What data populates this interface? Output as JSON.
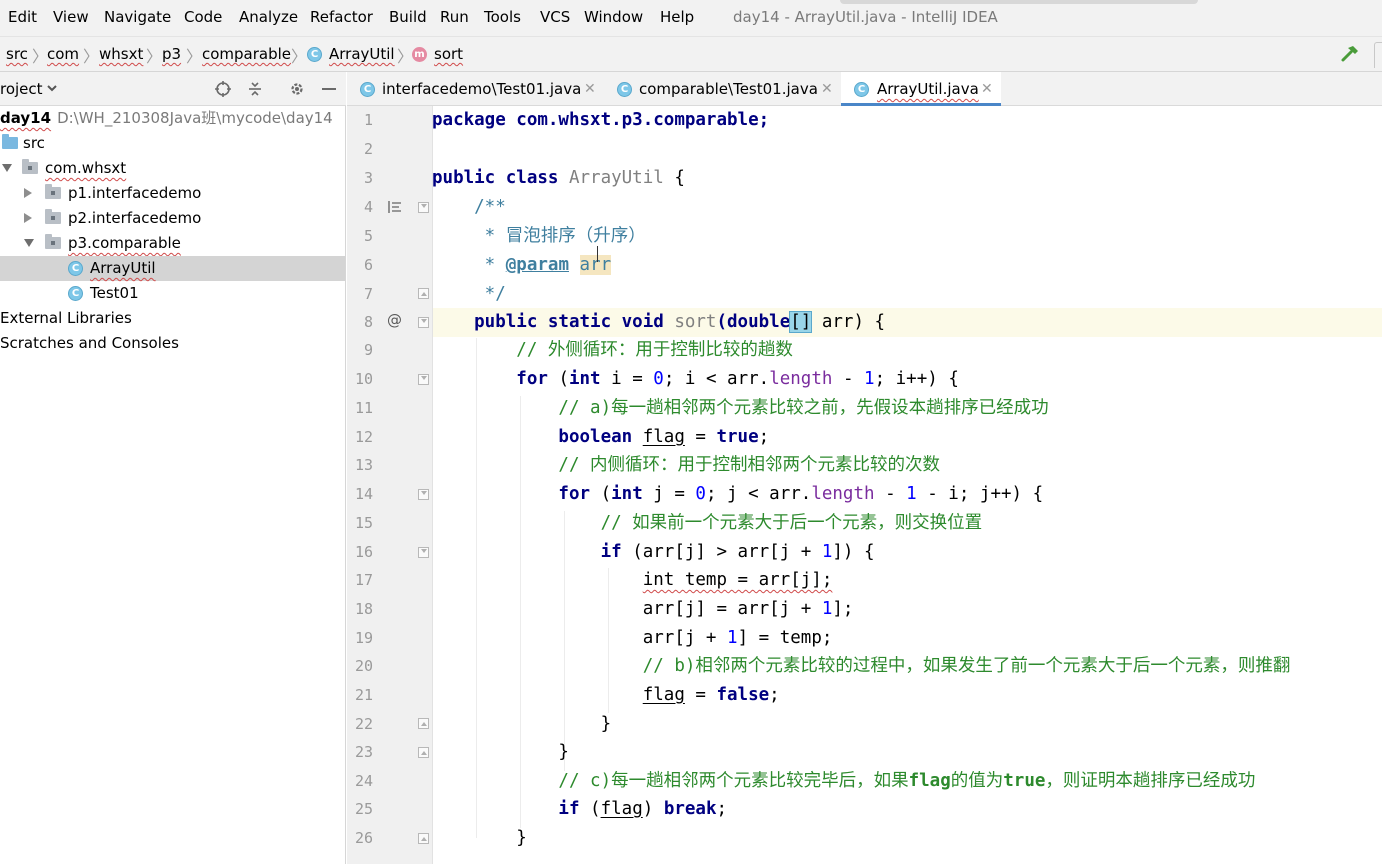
{
  "menu": {
    "items": [
      "Edit",
      "View",
      "Navigate",
      "Code",
      "Analyze",
      "Refactor",
      "Build",
      "Run",
      "Tools",
      "VCS",
      "Window",
      "Help"
    ],
    "window_title": "day14 - ArrayUtil.java - IntelliJ IDEA"
  },
  "breadcrumb": {
    "items": [
      "src",
      "com",
      "whsxt",
      "p3",
      "comparable",
      "ArrayUtil",
      "sort"
    ],
    "class_icon_letter": "C",
    "method_icon_letter": "m"
  },
  "project": {
    "title": "roject",
    "tree": [
      {
        "label": "day14",
        "path": "D:\\WH_210308Java班\\mycode\\day14"
      },
      {
        "label": "src"
      },
      {
        "label": "com.whsxt"
      },
      {
        "label": "p1.interfacedemo"
      },
      {
        "label": "p2.interfacedemo"
      },
      {
        "label": "p3.comparable"
      },
      {
        "label": "ArrayUtil"
      },
      {
        "label": "Test01"
      },
      {
        "label": "External Libraries"
      },
      {
        "label": "Scratches and Consoles"
      }
    ]
  },
  "tabs": [
    {
      "label": "interfacedemo\\Test01.java",
      "active": false
    },
    {
      "label": "comparable\\Test01.java",
      "active": false
    },
    {
      "label": "ArrayUtil.java",
      "active": true
    }
  ],
  "editor": {
    "line_numbers": [
      "1",
      "2",
      "3",
      "4",
      "5",
      "6",
      "7",
      "8",
      "9",
      "10",
      "11",
      "12",
      "13",
      "14",
      "15",
      "16",
      "17",
      "18",
      "19",
      "20",
      "21",
      "22",
      "23",
      "24",
      "25",
      "26"
    ],
    "gutter_at_marker": "@",
    "code": {
      "l1": "package com.whsxt.p3.comparable;",
      "l3_kw": "public class ",
      "l3_cls": "ArrayUtil",
      "l3_rest": " {",
      "l4": "    /**",
      "l5": "     * 冒泡排序（升序）",
      "l6_pre": "     * ",
      "l6_tag": "@param",
      "l6_arr": "arr",
      "l7": "     */",
      "l8_kw": "    public static void ",
      "l8_m": "sort",
      "l8_a": "(double",
      "l8_br": "[]",
      "l8_b": " arr) {",
      "l9": "        // 外侧循环：用于控制比较的趟数",
      "l10_kw": "        for",
      "l10_a": " (",
      "l10_int": "int",
      "l10_b": " i = ",
      "l10_n0": "0",
      "l10_c": "; i < arr.",
      "l10_len": "length",
      "l10_d": " - ",
      "l10_n1": "1",
      "l10_e": "; i++) {",
      "l11": "            // a)每一趟相邻两个元素比较之前，先假设本趟排序已经成功",
      "l12_kw": "            boolean ",
      "l12_flag": "flag",
      "l12_a": " = ",
      "l12_true": "true",
      "l12_b": ";",
      "l13": "            // 内侧循环：用于控制相邻两个元素比较的次数",
      "l14_kw": "            for",
      "l14_a": " (",
      "l14_int": "int",
      "l14_b": " j = ",
      "l14_n0": "0",
      "l14_c": "; j < arr.",
      "l14_len": "length",
      "l14_d": " - ",
      "l14_n1": "1",
      "l14_e": " - i; j++) {",
      "l15": "                // 如果前一个元素大于后一个元素，则交换位置",
      "l16_kw": "                if",
      "l16_a": " (arr[j] > arr[j + ",
      "l16_n1": "1",
      "l16_b": "]) {",
      "l17_pre": "                    ",
      "l17_u": "int temp = arr[j];",
      "l18_a": "                    arr[j] = arr[j + ",
      "l18_n1": "1",
      "l18_b": "];",
      "l19_a": "                    arr[j + ",
      "l19_n1": "1",
      "l19_b": "] = temp;",
      "l20": "                    // b)相邻两个元素比较的过程中，如果发生了前一个元素大于后一个元素，则推翻",
      "l21_pre": "                    ",
      "l21_flag": "flag",
      "l21_a": " = ",
      "l21_false": "false",
      "l21_b": ";",
      "l22": "                }",
      "l23": "            }",
      "l24_a": "            // c)每一趟相邻两个元素比较完毕后，如果",
      "l24_flag": "flag",
      "l24_b": "的值为",
      "l24_true": "true",
      "l24_c": "，则证明本趟排序已经成功",
      "l25_kw": "            if",
      "l25_a": " (",
      "l25_flag": "flag",
      "l25_b": ") ",
      "l25_break": "break",
      "l25_c": ";",
      "l26": "        }"
    }
  },
  "colors": {
    "keyword": "#000080",
    "comment": "#2d8a2d",
    "number": "#0000ff",
    "field": "#7a2c9e",
    "tab_underline": "#4a86c8",
    "caret_line": "#fcfae8"
  }
}
